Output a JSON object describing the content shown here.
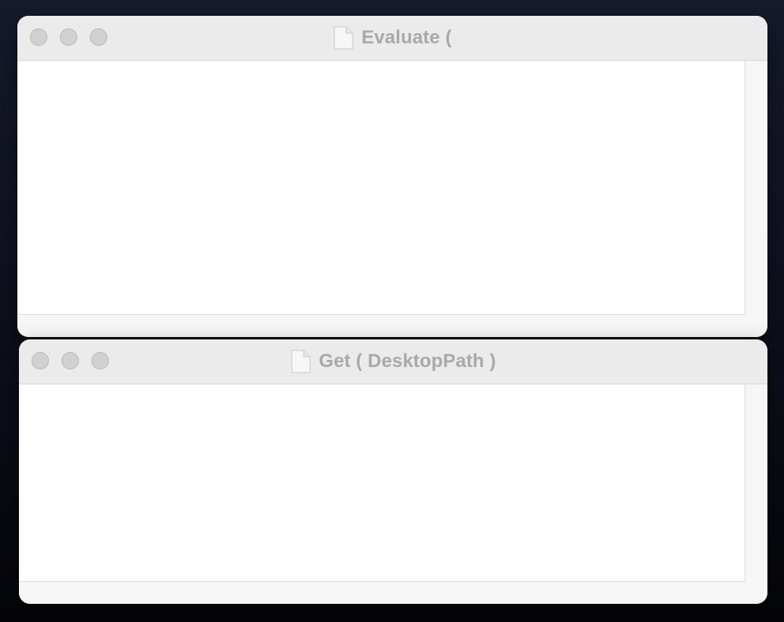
{
  "windows": [
    {
      "title": "Evaluate (",
      "icon": "document-icon"
    },
    {
      "title": "Get ( DesktopPath )",
      "icon": "document-icon"
    }
  ],
  "colors": {
    "title_text": "#a9a9a9",
    "titlebar_bg": "#ebebeb",
    "traffic_light_inactive": "#d1d1d1",
    "content_bg": "#ffffff"
  }
}
